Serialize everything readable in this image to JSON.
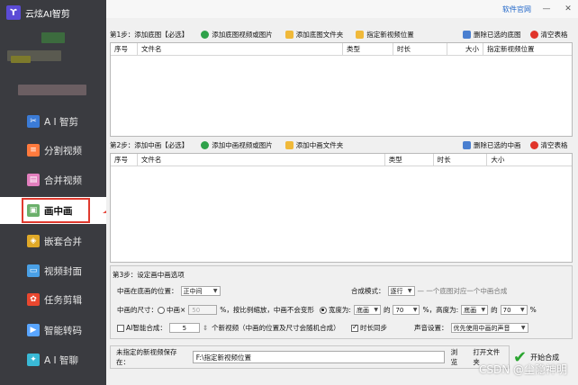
{
  "app": {
    "title": "云炫AI智剪"
  },
  "sidebar": {
    "items": [
      {
        "label": "A I 智剪",
        "icon": "ai-cut-icon",
        "color": "#6fa8ff"
      },
      {
        "label": "分割视频",
        "icon": "split-video-icon",
        "color": "#ff7a3d"
      },
      {
        "label": "合并视频",
        "icon": "merge-video-icon",
        "color": "#f29ad0"
      },
      {
        "label": "画中画",
        "icon": "picture-in-picture-icon",
        "color": "#e9e9e9"
      },
      {
        "label": "嵌套合并",
        "icon": "nested-merge-icon",
        "color": "#f7c44a"
      },
      {
        "label": "视频封面",
        "icon": "video-cover-icon",
        "color": "#4aa0e6"
      },
      {
        "label": "任务剪辑",
        "icon": "task-edit-icon",
        "color": "#f2583e"
      },
      {
        "label": "智能转码",
        "icon": "smart-transcode-icon",
        "color": "#59a5ff"
      },
      {
        "label": "A I 智聊",
        "icon": "ai-chat-icon",
        "color": "#39b9d6"
      }
    ],
    "active_index": 3
  },
  "topbar": {
    "link": "软件官网",
    "minimize": "—",
    "close": "✕"
  },
  "step1": {
    "title": "第1步：添加底图【必选】",
    "add_media": "添加底图视频或图片",
    "add_folder": "添加底图文件夹",
    "set_location": "指定新视频位置",
    "delete_selected": "删除已选的底图",
    "clear": "清空表格",
    "columns": [
      "序号",
      "文件名",
      "类型",
      "时长",
      "大小",
      "指定新视频位置"
    ]
  },
  "step2": {
    "title": "第2步：添加中画【必选】",
    "add_media": "添加中画视频或图片",
    "add_folder": "添加中画文件夹",
    "delete_selected": "删除已选的中画",
    "clear": "清空表格",
    "columns": [
      "序号",
      "文件名",
      "类型",
      "时长",
      "大小"
    ]
  },
  "step3": {
    "title": "第3步：设定画中画选项",
    "position_label": "中画在底画的位置：",
    "position_value": "正中间",
    "mode_label": "合成模式：",
    "mode_value": "逐行",
    "mode_hint": "— 一个底图对应一个中画合成",
    "size_label": "中画的尺寸：",
    "size_opt1": "中画×",
    "size_pct": "50",
    "size_hint": "%，按比例缩放，中画不会变形",
    "size_opt2": "宽度为:",
    "width_base": "底画",
    "of1": "的",
    "width_pct": "70",
    "height_label": "%，高度为:",
    "height_base": "底画",
    "of2": "的",
    "height_pct": "70",
    "pct": "%",
    "ai_label": "AI智能合成：",
    "ai_count": "5",
    "ai_hint": "个新视频（中画的位置及尺寸会随机合成）",
    "sync_label": "时长同步",
    "audio_label": "声音设置：",
    "audio_value": "优先使用中画的声音"
  },
  "save": {
    "label": "未指定的新视频保存在：",
    "path": "F:\\指定新视频位置",
    "browse": "浏览",
    "open": "打开文件夹"
  },
  "start": {
    "label": "开始合成"
  },
  "watermark": "CSDN @尘隐神明"
}
